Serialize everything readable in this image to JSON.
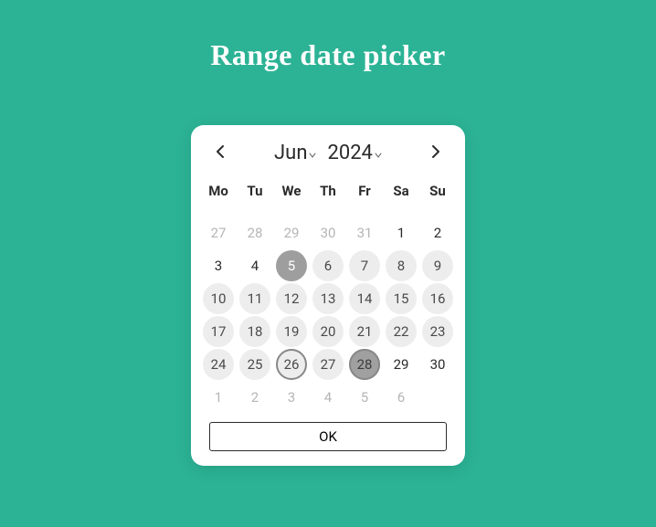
{
  "title": "Range date picker",
  "header": {
    "month": "Jun",
    "year": "2024"
  },
  "weekdays": [
    "Mo",
    "Tu",
    "We",
    "Th",
    "Fr",
    "Sa",
    "Su"
  ],
  "days": [
    {
      "n": 27,
      "other": true
    },
    {
      "n": 28,
      "other": true
    },
    {
      "n": 29,
      "other": true
    },
    {
      "n": 30,
      "other": true
    },
    {
      "n": 31,
      "other": true
    },
    {
      "n": 1
    },
    {
      "n": 2
    },
    {
      "n": 3
    },
    {
      "n": 4
    },
    {
      "n": 5,
      "rangeStart": true
    },
    {
      "n": 6,
      "inRange": true
    },
    {
      "n": 7,
      "inRange": true
    },
    {
      "n": 8,
      "inRange": true
    },
    {
      "n": 9,
      "inRange": true
    },
    {
      "n": 10,
      "inRange": true
    },
    {
      "n": 11,
      "inRange": true
    },
    {
      "n": 12,
      "inRange": true
    },
    {
      "n": 13,
      "inRange": true
    },
    {
      "n": 14,
      "inRange": true
    },
    {
      "n": 15,
      "inRange": true
    },
    {
      "n": 16,
      "inRange": true
    },
    {
      "n": 17,
      "inRange": true
    },
    {
      "n": 18,
      "inRange": true
    },
    {
      "n": 19,
      "inRange": true
    },
    {
      "n": 20,
      "inRange": true
    },
    {
      "n": 21,
      "inRange": true
    },
    {
      "n": 22,
      "inRange": true
    },
    {
      "n": 23,
      "inRange": true
    },
    {
      "n": 24,
      "inRange": true
    },
    {
      "n": 25,
      "inRange": true
    },
    {
      "n": 26,
      "inRange": true,
      "today": true
    },
    {
      "n": 27,
      "inRange": true
    },
    {
      "n": 28,
      "rangeEnd": true
    },
    {
      "n": 29
    },
    {
      "n": 30
    },
    {
      "n": 1,
      "other": true
    },
    {
      "n": 2,
      "other": true
    },
    {
      "n": 3,
      "other": true
    },
    {
      "n": 4,
      "other": true
    },
    {
      "n": 5,
      "other": true
    },
    {
      "n": 6,
      "other": true
    }
  ],
  "footer": {
    "ok_label": "OK"
  }
}
